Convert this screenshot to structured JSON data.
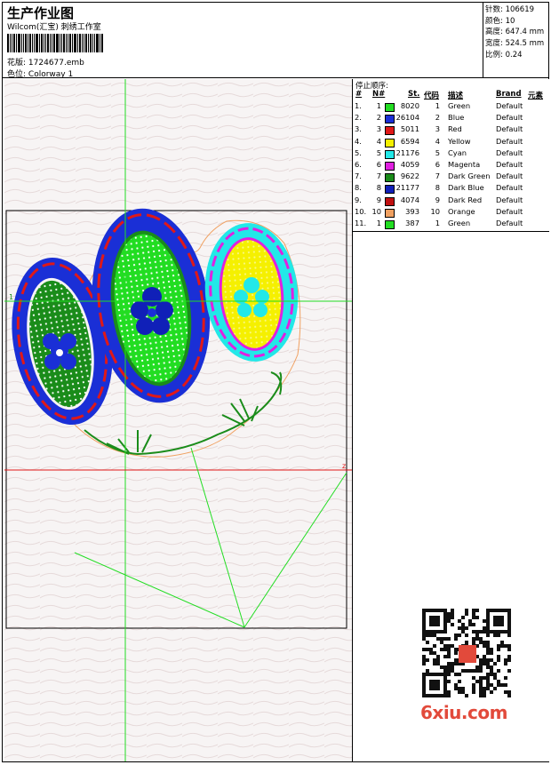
{
  "header": {
    "title": "生产作业图",
    "company": "Wilcom(汇宝) 刺绣工作室",
    "design_label": "花版:",
    "design_file": "1724677.emb",
    "colorway_label": "色位:",
    "colorway_value": "Colorway 1"
  },
  "stats": {
    "stitches_label": "针数:",
    "stitches_value": "106619",
    "colors_label": "颜色:",
    "colors_value": "10",
    "height_label": "高度:",
    "height_value": "647.4 mm",
    "width_label": "宽度:",
    "width_value": "524.5 mm",
    "scale_label": "比例:",
    "scale_value": "0.24"
  },
  "stop_sequence": {
    "title": "停止顺序:",
    "headers": [
      "#",
      "N#",
      "St.",
      "代码",
      "描述",
      "Brand",
      "元素"
    ],
    "rows": [
      {
        "idx": "1.",
        "n": "1",
        "st": "8020",
        "code": "1",
        "desc": "Green",
        "brand": "Default",
        "color": "#22dd22"
      },
      {
        "idx": "2.",
        "n": "2",
        "st": "26104",
        "code": "2",
        "desc": "Blue",
        "brand": "Default",
        "color": "#1a2fd6"
      },
      {
        "idx": "3.",
        "n": "3",
        "st": "5011",
        "code": "3",
        "desc": "Red",
        "brand": "Default",
        "color": "#e01818"
      },
      {
        "idx": "4.",
        "n": "4",
        "st": "6594",
        "code": "4",
        "desc": "Yellow",
        "brand": "Default",
        "color": "#f5f000"
      },
      {
        "idx": "5.",
        "n": "5",
        "st": "21176",
        "code": "5",
        "desc": "Cyan",
        "brand": "Default",
        "color": "#22e8e8"
      },
      {
        "idx": "6.",
        "n": "6",
        "st": "4059",
        "code": "6",
        "desc": "Magenta",
        "brand": "Default",
        "color": "#e020e0"
      },
      {
        "idx": "7.",
        "n": "7",
        "st": "9622",
        "code": "7",
        "desc": "Dark Green",
        "brand": "Default",
        "color": "#1a8c1a"
      },
      {
        "idx": "8.",
        "n": "8",
        "st": "21177",
        "code": "8",
        "desc": "Dark Blue",
        "brand": "Default",
        "color": "#1020b8"
      },
      {
        "idx": "9.",
        "n": "9",
        "st": "4074",
        "code": "9",
        "desc": "Dark Red",
        "brand": "Default",
        "color": "#c01010"
      },
      {
        "idx": "10.",
        "n": "10",
        "st": "393",
        "code": "10",
        "desc": "Orange",
        "brand": "Default",
        "color": "#f0a060"
      },
      {
        "idx": "11.",
        "n": "1",
        "st": "387",
        "code": "1",
        "desc": "Green",
        "brand": "Default",
        "color": "#22dd22"
      }
    ]
  },
  "watermark": "6xiu.com",
  "canvas": {
    "origin_marker": "1",
    "axis_marker": "z"
  }
}
